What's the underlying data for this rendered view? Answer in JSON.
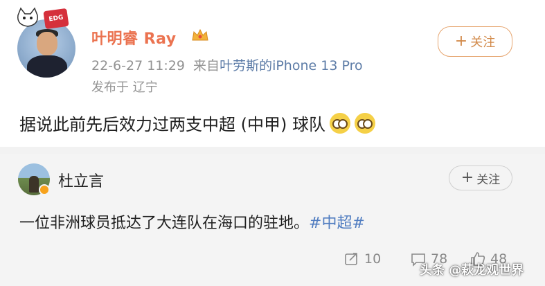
{
  "post1": {
    "author": "叶明睿 Ray",
    "time": "22-6-27 11:29",
    "source_prefix": "来自",
    "source": "叶劳斯的iPhone 13 Pro",
    "location": "发布于 辽宁",
    "follow_label": "关注",
    "text": "据说此前先后效力过两支中超 (中甲) 球队",
    "badge_text": "EDG"
  },
  "post2": {
    "author": "杜立言",
    "follow_label": "关注",
    "text": "一位非洲球员抵达了大连队在海口的驻地。",
    "hashtag": "#中超#",
    "repost_count": "10",
    "comment_count": "78",
    "like_count": "48"
  },
  "watermark": "头条 @萩龙观世界",
  "colors": {
    "name_orange": "#eb7350",
    "source_blue": "#5d7ca7",
    "hashtag_blue": "#4f7cc0",
    "follow_orange": "#d28a4a"
  }
}
